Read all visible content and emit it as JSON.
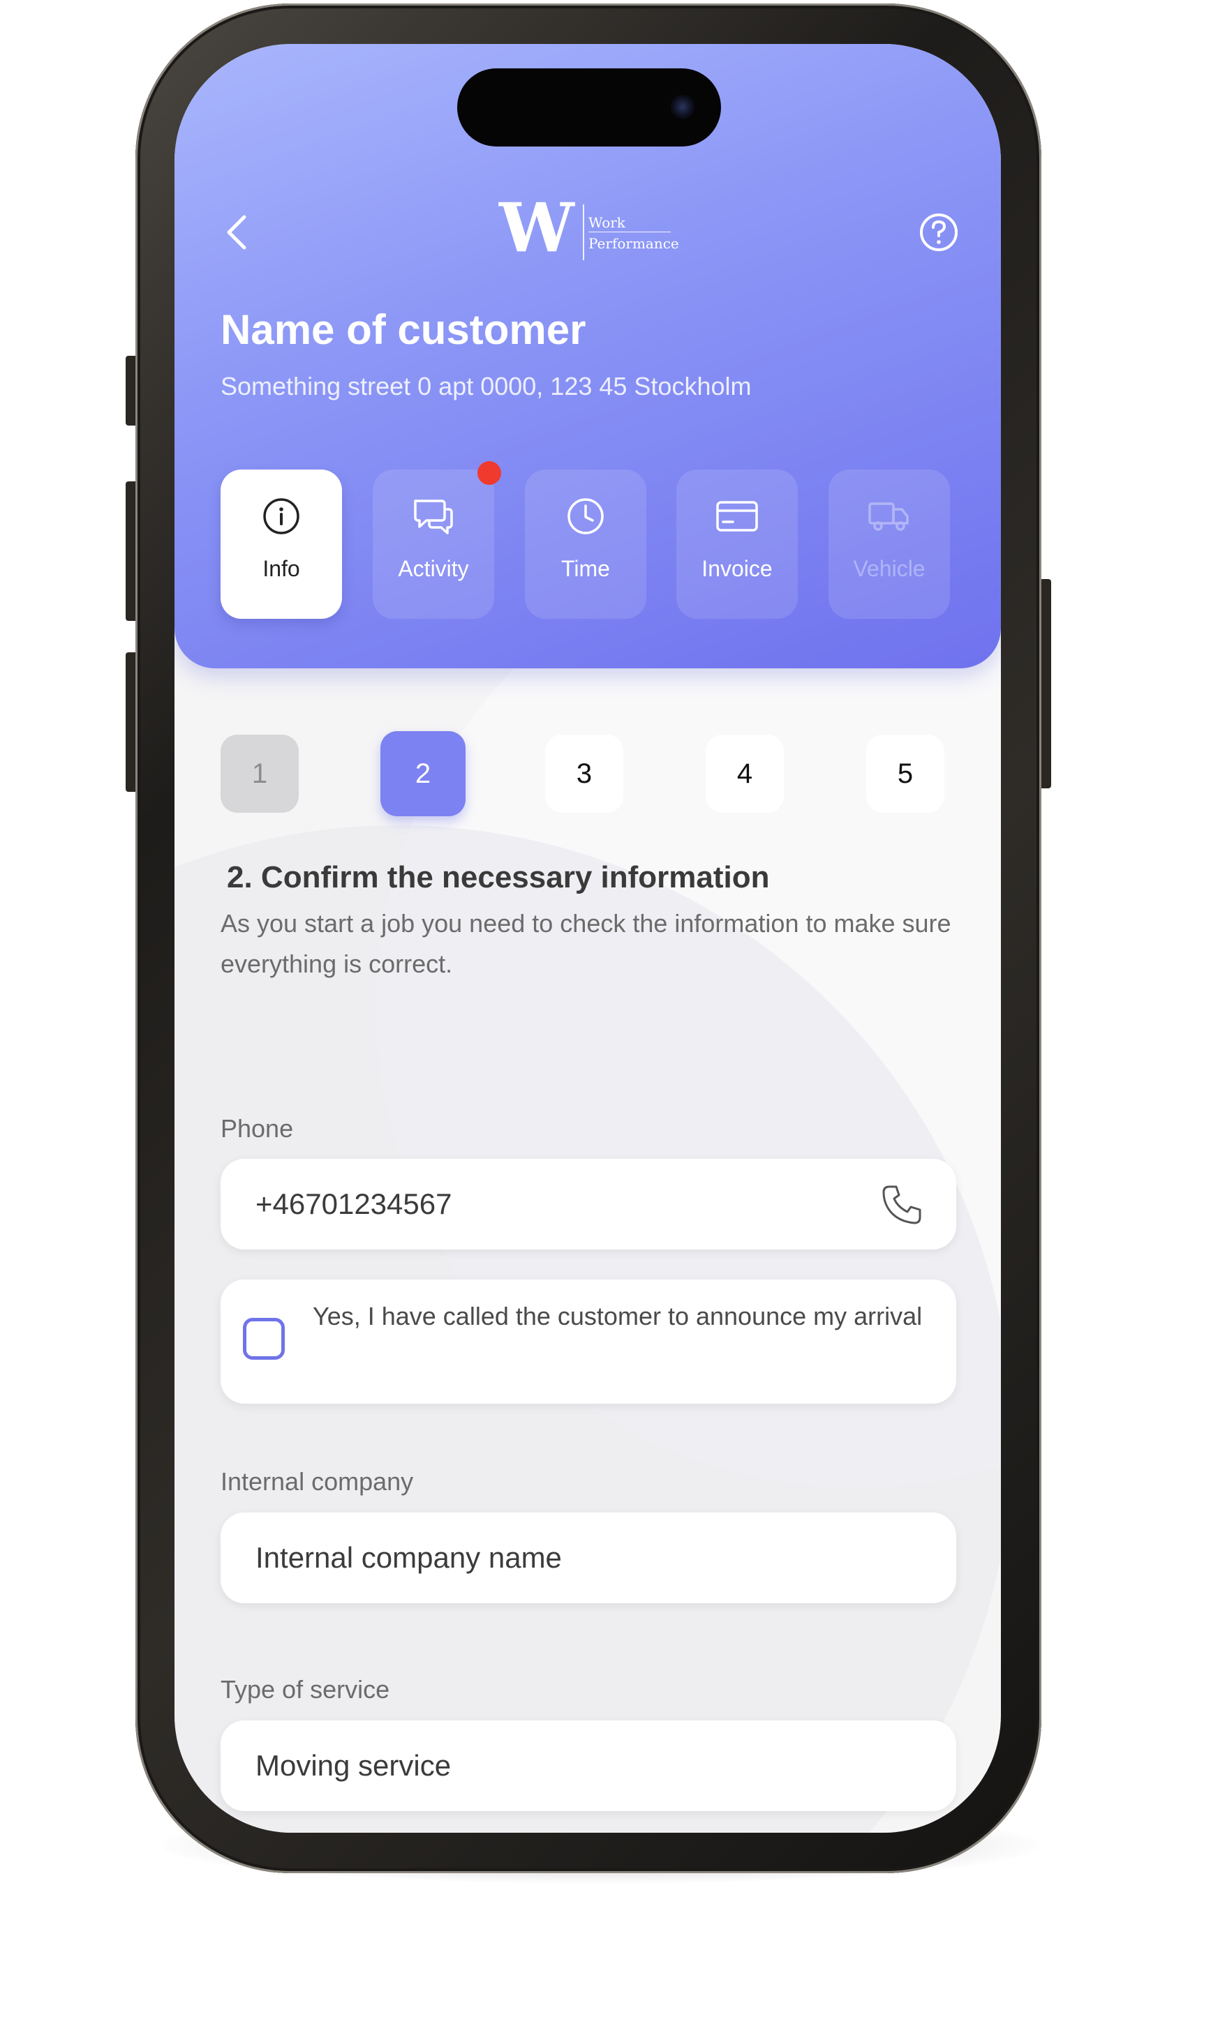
{
  "header": {
    "logo_line1": "Work",
    "logo_line2": "Performance",
    "logo_mark": "W",
    "customer_name": "Name of customer",
    "customer_address": "Something street 0 apt 0000, 123 45 Stockholm",
    "icons": {
      "back": "chevron-left-icon",
      "help": "help-circle-icon"
    }
  },
  "tabs": [
    {
      "label": "Info",
      "icon": "info-icon",
      "state": "active"
    },
    {
      "label": "Activity",
      "icon": "chat-icon",
      "state": "normal",
      "badge": true
    },
    {
      "label": "Time",
      "icon": "clock-icon",
      "state": "normal"
    },
    {
      "label": "Invoice",
      "icon": "card-icon",
      "state": "normal"
    },
    {
      "label": "Vehicle",
      "icon": "truck-icon",
      "state": "disabled"
    }
  ],
  "steps": [
    {
      "label": "1",
      "state": "done"
    },
    {
      "label": "2",
      "state": "current"
    },
    {
      "label": "3",
      "state": "upcoming"
    },
    {
      "label": "4",
      "state": "upcoming"
    },
    {
      "label": "5",
      "state": "upcoming"
    }
  ],
  "section": {
    "title": "2. Confirm the necessary information",
    "description": "As you start a job you need to check the information to make sure everything is correct."
  },
  "form": {
    "phone_label": "Phone",
    "phone_value": "+46701234567",
    "call_checkbox_label": "Yes, I have called the customer to announce my arrival",
    "call_checkbox_checked": false,
    "company_label": "Internal company",
    "company_value": "Internal company name",
    "service_label": "Type of service",
    "service_value": "Moving service"
  },
  "colors": {
    "accent": "#7c82f1",
    "header_gradient_start": "#a9b6fc",
    "header_gradient_end": "#6f72ee",
    "notification": "#f03a2e",
    "screen_bg": "#f5f5f6"
  }
}
